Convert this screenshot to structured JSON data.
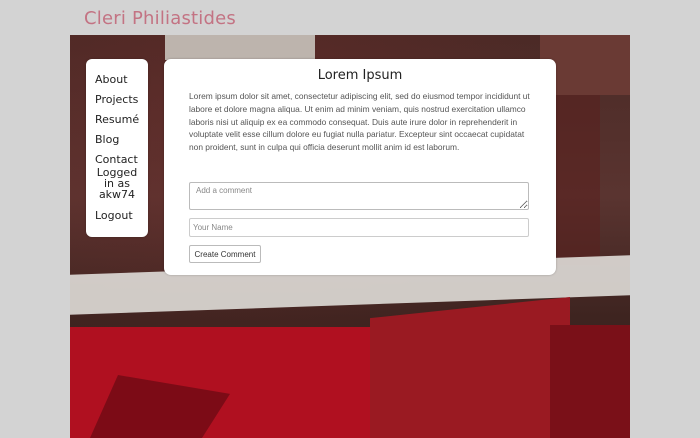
{
  "site": {
    "title": "Cleri Philiastides"
  },
  "nav": {
    "about": "About",
    "projects": "Projects",
    "resume": "Resumé",
    "blog": "Blog",
    "contact": "Contact",
    "status_lines": [
      "Logged",
      "in as",
      "akw74"
    ],
    "logout": "Logout"
  },
  "post": {
    "title": "Lorem Ipsum",
    "body": "Lorem ipsum dolor sit amet, consectetur adipiscing elit, sed do eiusmod tempor incididunt ut labore et dolore magna aliqua. Ut enim ad minim veniam, quis nostrud exercitation ullamco laboris nisi ut aliquip ex ea commodo consequat. Duis aute irure dolor in reprehenderit in voluptate velit esse cillum dolore eu fugiat nulla pariatur. Excepteur sint occaecat cupidatat non proident, sunt in culpa qui officia deserunt mollit anim id est laborum."
  },
  "comment_form": {
    "comment_placeholder": "Add a comment",
    "name_placeholder": "Your Name",
    "submit_label": "Create Comment"
  },
  "colors": {
    "page_background": "#d3d3d3",
    "title_accent": "#c37383",
    "panel_background": "#ffffff"
  }
}
